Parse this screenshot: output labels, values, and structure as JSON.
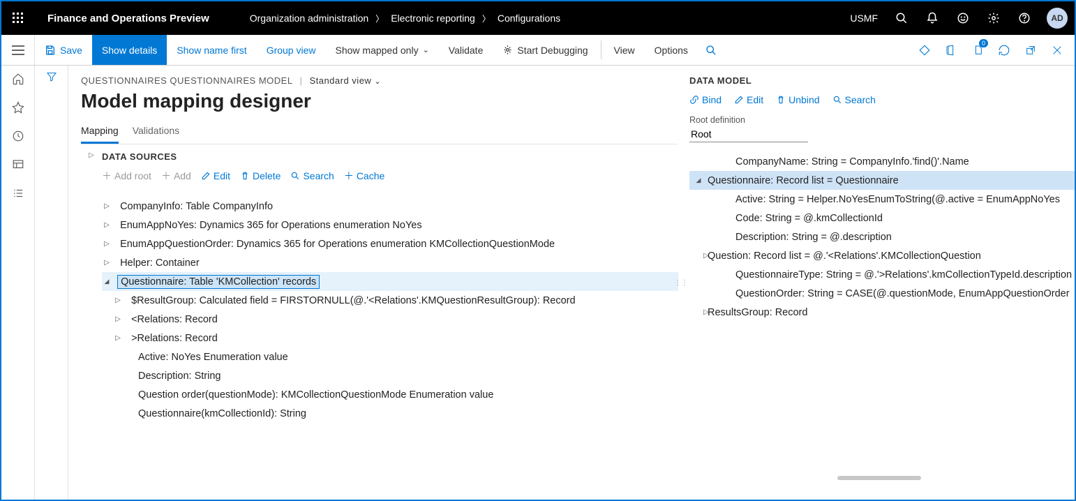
{
  "header": {
    "app_title": "Finance and Operations Preview",
    "breadcrumb": [
      "Organization administration",
      "Electronic reporting",
      "Configurations"
    ],
    "company": "USMF",
    "avatar": "AD"
  },
  "toolbar": {
    "save": "Save",
    "show_details": "Show details",
    "show_name_first": "Show name first",
    "group_view": "Group view",
    "show_mapped_only": "Show mapped only",
    "validate": "Validate",
    "start_debugging": "Start Debugging",
    "view": "View",
    "options": "Options",
    "badge": "0"
  },
  "page": {
    "context": "QUESTIONNAIRES QUESTIONNAIRES MODEL",
    "view_name": "Standard view",
    "title": "Model mapping designer",
    "tabs": {
      "mapping": "Mapping",
      "validations": "Validations"
    }
  },
  "data_sources": {
    "title": "DATA SOURCES",
    "actions": {
      "add_root": "Add root",
      "add": "Add",
      "edit": "Edit",
      "delete": "Delete",
      "search": "Search",
      "cache": "Cache"
    },
    "tree": [
      {
        "label": "CompanyInfo: Table CompanyInfo",
        "expandable": true,
        "indent": 0
      },
      {
        "label": "EnumAppNoYes: Dynamics 365 for Operations enumeration NoYes",
        "expandable": true,
        "indent": 0
      },
      {
        "label": "EnumAppQuestionOrder: Dynamics 365 for Operations enumeration KMCollectionQuestionMode",
        "expandable": true,
        "indent": 0
      },
      {
        "label": "Helper: Container",
        "expandable": true,
        "indent": 0
      },
      {
        "label": "Questionnaire: Table 'KMCollection' records",
        "expandable": true,
        "expanded": true,
        "indent": 0,
        "selected": true
      },
      {
        "label": "$ResultGroup: Calculated field = FIRSTORNULL(@.'<Relations'.KMQuestionResultGroup): Record",
        "expandable": true,
        "indent": 1
      },
      {
        "label": "<Relations: Record",
        "expandable": true,
        "indent": 1
      },
      {
        "label": ">Relations: Record",
        "expandable": true,
        "indent": 1
      },
      {
        "label": "Active: NoYes Enumeration value",
        "expandable": false,
        "indent": 1
      },
      {
        "label": "Description: String",
        "expandable": false,
        "indent": 1
      },
      {
        "label": "Question order(questionMode): KMCollectionQuestionMode Enumeration value",
        "expandable": false,
        "indent": 1
      },
      {
        "label": "Questionnaire(kmCollectionId): String",
        "expandable": false,
        "indent": 1
      }
    ]
  },
  "data_model": {
    "title": "DATA MODEL",
    "actions": {
      "bind": "Bind",
      "edit": "Edit",
      "unbind": "Unbind",
      "search": "Search"
    },
    "root_label": "Root definition",
    "root_value": "Root",
    "tree": [
      {
        "label": "CompanyName: String = CompanyInfo.'find()'.Name",
        "indent": 2,
        "leaf": true
      },
      {
        "label": "Questionnaire: Record list = Questionnaire",
        "indent": 1,
        "expandable": true,
        "expanded": true,
        "selected": true
      },
      {
        "label": "Active: String = Helper.NoYesEnumToString(@.active = EnumAppNoYes",
        "indent": 2,
        "leaf": true
      },
      {
        "label": "Code: String = @.kmCollectionId",
        "indent": 2,
        "leaf": true
      },
      {
        "label": "Description: String = @.description",
        "indent": 2,
        "leaf": true
      },
      {
        "label": "Question: Record list = @.'<Relations'.KMCollectionQuestion",
        "indent": 2,
        "expandable": true
      },
      {
        "label": "QuestionnaireType: String = @.'>Relations'.kmCollectionTypeId.description",
        "indent": 2,
        "leaf": true
      },
      {
        "label": "QuestionOrder: String = CASE(@.questionMode, EnumAppQuestionOrder",
        "indent": 2,
        "leaf": true
      },
      {
        "label": "ResultsGroup: Record",
        "indent": 2,
        "expandable": true
      }
    ]
  }
}
